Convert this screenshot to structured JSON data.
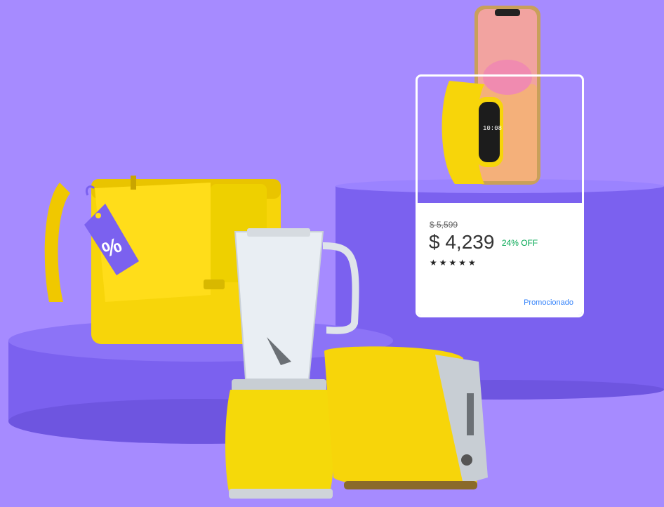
{
  "promo_card": {
    "old_price": "$ 5,599",
    "price": "$ 4,239",
    "discount": "24% OFF",
    "rating_stars": 5,
    "stars_text": "★★★★★",
    "promoted_label": "Promocionado"
  },
  "tag_label": "%",
  "colors": {
    "background": "#a68bff",
    "podium": "#7b61ef",
    "product_yellow": "#f5d90a",
    "discount_green": "#00a650",
    "link_blue": "#3483fa"
  }
}
